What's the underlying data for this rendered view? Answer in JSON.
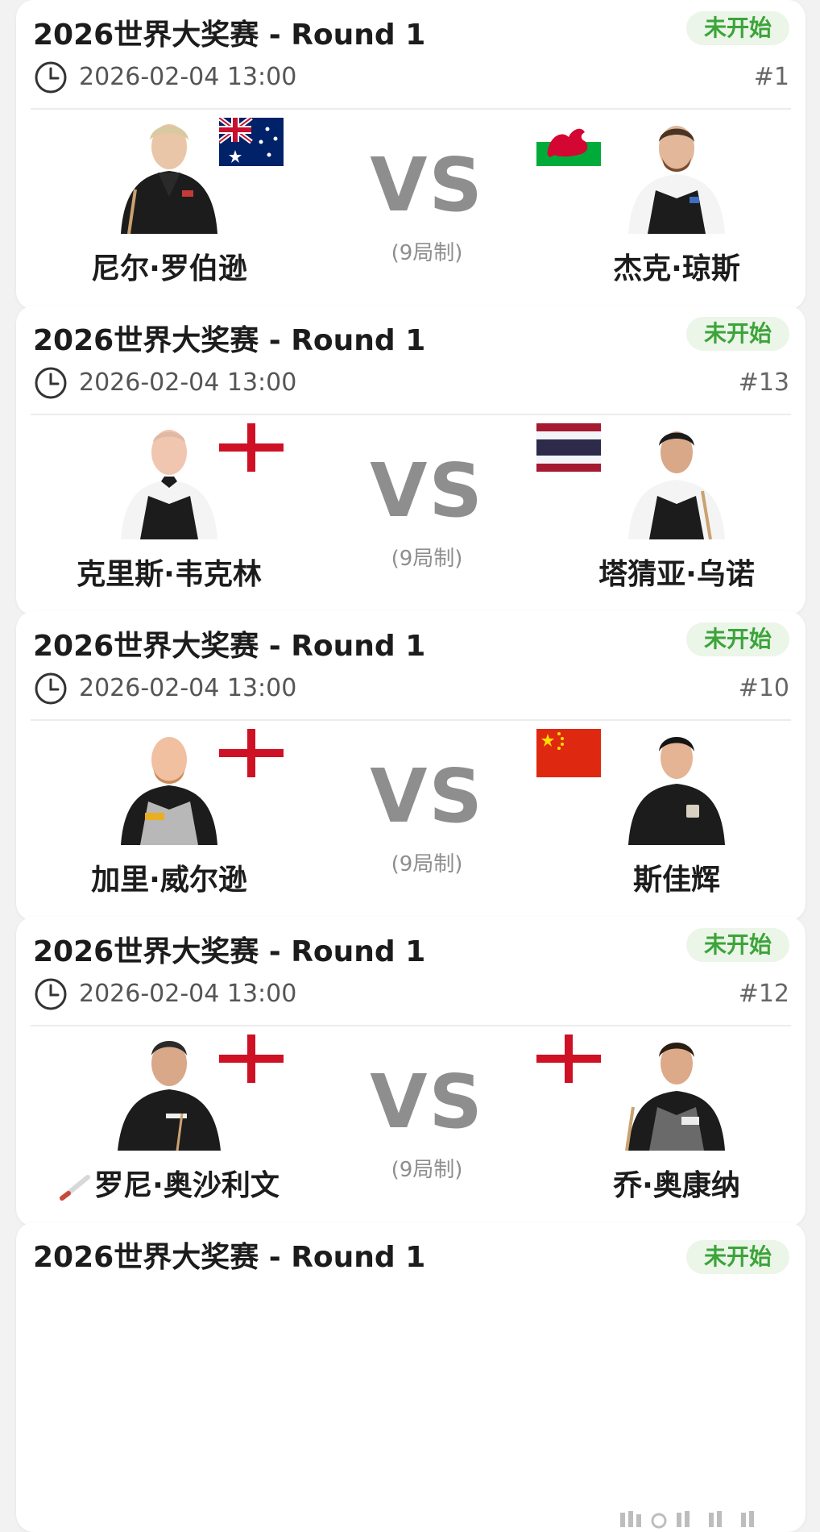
{
  "colors": {
    "status_green": "#3ca43a",
    "status_bg": "#ebf5e8",
    "vs_gray": "#8e8e8e"
  },
  "matches": [
    {
      "title": "2026世界大奖赛 - Round 1",
      "status": "未开始",
      "time": "2026-02-04 13:00",
      "number": "#1",
      "vs": "VS",
      "format": "(9局制)",
      "player1": {
        "name": "尼尔·罗伯逊",
        "flag": "australia-flag",
        "portrait": "player-portrait"
      },
      "player2": {
        "name": "杰克·琼斯",
        "flag": "wales-flag",
        "portrait": "player-portrait"
      }
    },
    {
      "title": "2026世界大奖赛 - Round 1",
      "status": "未开始",
      "time": "2026-02-04 13:00",
      "number": "#13",
      "vs": "VS",
      "format": "(9局制)",
      "player1": {
        "name": "克里斯·韦克林",
        "flag": "england-flag",
        "portrait": "player-portrait"
      },
      "player2": {
        "name": "塔猜亚·乌诺",
        "flag": "thailand-flag",
        "portrait": "player-portrait"
      }
    },
    {
      "title": "2026世界大奖赛 - Round 1",
      "status": "未开始",
      "time": "2026-02-04 13:00",
      "number": "#10",
      "vs": "VS",
      "format": "(9局制)",
      "player1": {
        "name": "加里·威尔逊",
        "flag": "england-flag",
        "portrait": "player-portrait"
      },
      "player2": {
        "name": "斯佳辉",
        "flag": "china-flag",
        "portrait": "player-portrait"
      }
    },
    {
      "title": "2026世界大奖赛 - Round 1",
      "status": "未开始",
      "time": "2026-02-04 13:00",
      "number": "#12",
      "vs": "VS",
      "format": "(9局制)",
      "player1": {
        "name": "罗尼·奥沙利文",
        "flag": "england-flag",
        "portrait": "player-portrait",
        "badge": "cue-icon"
      },
      "player2": {
        "name": "乔·奥康纳",
        "flag": "england-flag",
        "portrait": "player-portrait"
      }
    },
    {
      "title": "2026世界大奖赛 - Round 1",
      "status": "未开始"
    }
  ]
}
